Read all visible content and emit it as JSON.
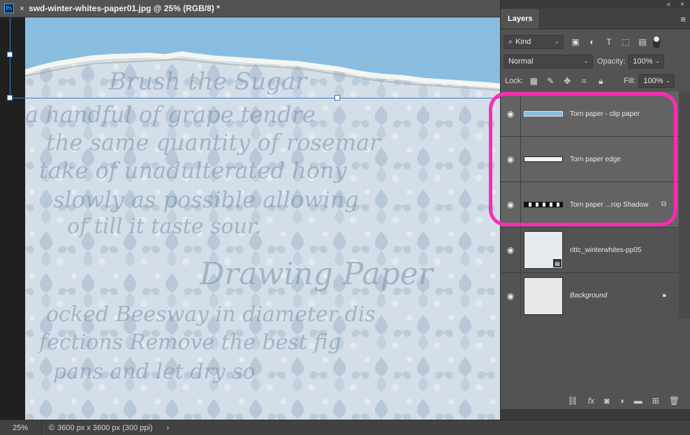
{
  "document": {
    "tab_title": "swd-winter-whites-paper01.jpg @ 25% (RGB/8) *",
    "app_icon_label": "Ps",
    "close_glyph": "×"
  },
  "canvas": {
    "script_lines": [
      "Brush the Sugar",
      "a handful of grape tendre",
      "the same quantity of rosemar",
      "take of unadulterated hony",
      "slowly as possible allowing",
      "of till it taste sour.",
      "Drawing Paper",
      "ocked Beesway in diameter dis",
      "fections Remove the best fig",
      "pans and let dry so"
    ]
  },
  "status_bar": {
    "zoom": "25%",
    "doc_info": "3600 px x 3600 px (300 ppi)",
    "arrow": "›"
  },
  "layers_panel": {
    "collapse_glyph": "«",
    "close_glyph": "×",
    "tab_label": "Layers",
    "menu_glyph": "≡",
    "filter": {
      "search_glyph": "⌕",
      "value": "Kind"
    },
    "blend_mode": "Normal",
    "opacity_label": "Opacity:",
    "opacity_value": "100%",
    "lock_label": "Lock:",
    "fill_label": "Fill:",
    "fill_value": "100%",
    "layers": [
      {
        "name": "Torn paper - clip paper",
        "selected": true
      },
      {
        "name": "Torn paper edge",
        "selected": true
      },
      {
        "name": "Torn paper ...rop Shadow",
        "selected": true
      },
      {
        "name": "rittc_winterwhites-pp05",
        "selected": false
      },
      {
        "name": "Background",
        "selected": false
      }
    ],
    "highlight_color": "#ff2bb3"
  },
  "colors": {
    "panel_bg": "#535353",
    "sky": "#89bde0",
    "selection": "#3b7bd4"
  }
}
